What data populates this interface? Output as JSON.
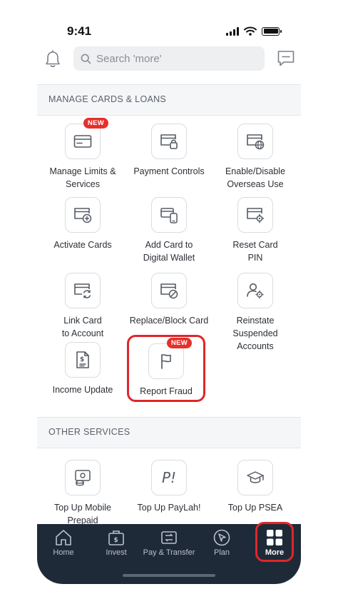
{
  "status_bar": {
    "time": "9:41"
  },
  "header": {
    "search_placeholder": "Search 'more'"
  },
  "sections": {
    "manage": {
      "title": "MANAGE CARDS & LOANS",
      "tiles": [
        {
          "label": "Manage Limits &\nServices",
          "icon": "card-settings-icon",
          "badge": "NEW"
        },
        {
          "label": "Payment Controls",
          "icon": "card-lock-icon"
        },
        {
          "label": "Enable/Disable\nOverseas Use",
          "icon": "card-globe-icon"
        },
        {
          "label": "Activate Cards",
          "icon": "card-plus-icon"
        },
        {
          "label": "Add Card to\nDigital Wallet",
          "icon": "card-wallet-icon"
        },
        {
          "label": "Reset Card\nPIN",
          "icon": "card-gear-icon"
        },
        {
          "label": "Link Card\nto Account",
          "icon": "card-sync-icon"
        },
        {
          "label": "Replace/Block Card",
          "icon": "card-block-icon"
        },
        {
          "label": "Reinstate Suspended\nAccounts",
          "icon": "user-gear-icon"
        },
        {
          "label": "Income Update",
          "icon": "dollar-document-icon"
        },
        {
          "label": "Report Fraud",
          "icon": "flag-icon",
          "badge": "NEW"
        }
      ]
    },
    "other": {
      "title": "OTHER SERVICES",
      "tiles": [
        {
          "label": "Top Up Mobile\nPrepaid",
          "icon": "mobile-topup-icon"
        },
        {
          "label": "Top Up PayLah!",
          "icon": "paylah-icon",
          "glyph": "P!"
        },
        {
          "label": "Top Up PSEA",
          "icon": "graduation-cap-icon"
        }
      ]
    }
  },
  "bottom_nav": {
    "items": [
      {
        "label": "Home",
        "icon": "home-icon"
      },
      {
        "label": "Invest",
        "icon": "invest-icon"
      },
      {
        "label": "Pay & Transfer",
        "icon": "pay-transfer-icon"
      },
      {
        "label": "Plan",
        "icon": "plan-icon"
      },
      {
        "label": "More",
        "icon": "grid-icon",
        "active": true
      }
    ]
  },
  "colors": {
    "accent_red": "#e0262a",
    "badge_red": "#e5302b",
    "nav_background": "#1f2a38"
  }
}
